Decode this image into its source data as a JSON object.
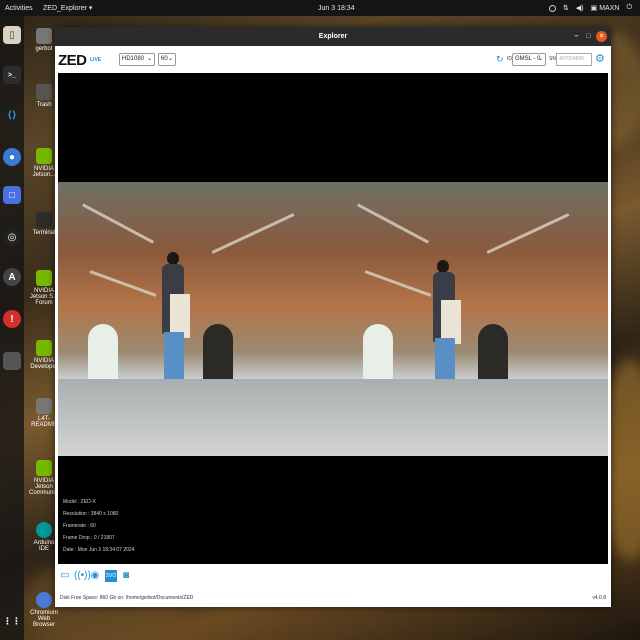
{
  "topbar": {
    "activities": "Activities",
    "app_menu": "ZED_Explorer ▾",
    "clock": "Jun 3  18:34",
    "power_mode": "MAXN"
  },
  "desktop": {
    "icons": [
      {
        "label": "gerbot",
        "color": "#6b6b6b"
      },
      {
        "label": "Trash",
        "color": "#5a5a5a"
      },
      {
        "label": "NVIDIA Jetson...",
        "color": "#76b900"
      },
      {
        "label": "Terminal",
        "color": "#2c2c2c"
      },
      {
        "label": "NVIDIA Jetson S... Forum",
        "color": "#76b900"
      },
      {
        "label": "NVIDIA Developer",
        "color": "#76b900"
      },
      {
        "label": "L4T-README",
        "color": "#777777"
      },
      {
        "label": "NVIDIA Jetson Community",
        "color": "#76b900"
      },
      {
        "label": "Arduino IDE",
        "color": "#00979d"
      },
      {
        "label": "Chromium Web Browser",
        "color": "#4a7bd8"
      }
    ]
  },
  "dock": {
    "icons": [
      "files-icon",
      "terminal-icon",
      "vscode-icon",
      "chromium-icon",
      "screenshot-icon",
      "obs-icon",
      "software-icon",
      "help-icon",
      "apps-grid-icon"
    ]
  },
  "window": {
    "title": "Explorer"
  },
  "toolbar": {
    "logo": "ZED",
    "live": "LIVE",
    "resolution": "HD1080",
    "fps": "60",
    "id_label": "ID",
    "camera_id": "GMSL - 0",
    "sn_label": "SN",
    "sn_placeholder": "407004896"
  },
  "info": {
    "model": "Model : ZED-X",
    "resolution": "Resolution : 3840 x 1080",
    "framerate": "Framerate : 60",
    "frame_drop": "Frame Drop : 0 / 21807",
    "date": "Date : Mon Jun 3 18:34:07 2024"
  },
  "bottombar": {
    "tools": [
      "folder-icon",
      "stream-icon",
      "record-icon",
      "svo-icon",
      "snapshot-icon"
    ],
    "disk": "Disk Free Space: 860 Gb  on: /home/gerbot/Documents/ZED",
    "version": "v4.0.8"
  },
  "colors": {
    "accent": "#1f8fd6",
    "close_button": "#e95420",
    "titlebar": "#2b2b2b"
  }
}
